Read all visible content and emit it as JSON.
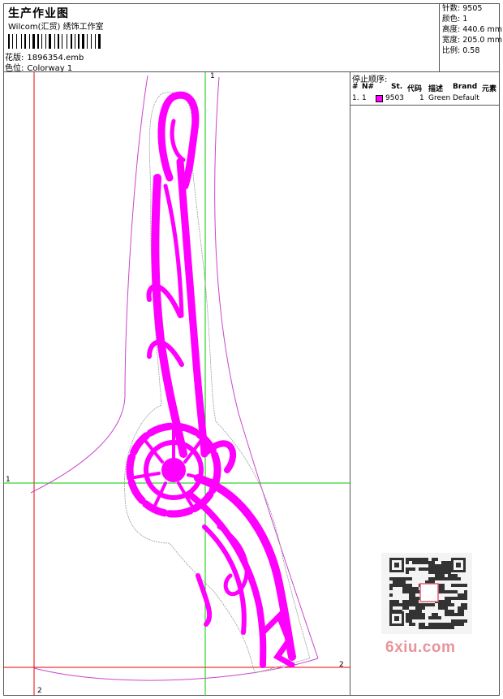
{
  "header": {
    "title": "生产作业图",
    "company": "Wilcom(汇贸) 绣饰工作室",
    "pattern_label": "花版:",
    "pattern_value": "1896354.emb",
    "colorway_label": "色位:",
    "colorway_value": "Colorway 1"
  },
  "stats": {
    "stitches_label": "针数:",
    "stitches_value": "9505",
    "colors_label": "颜色:",
    "colors_value": "1",
    "height_label": "高度:",
    "height_value": "440.6 mm",
    "width_label": "宽度:",
    "width_value": "205.0 mm",
    "scale_label": "比例:",
    "scale_value": "0.58"
  },
  "stop_sequence": {
    "title": "停止顺序:",
    "columns": [
      "#",
      "N#",
      "St.",
      "代码",
      "描述",
      "Brand",
      "元素"
    ],
    "rows": [
      {
        "index": "1.",
        "n": "1",
        "stitches": "9503",
        "code": "1",
        "description": "Green",
        "brand": "Default",
        "element": "",
        "swatch_color": "#ff00ff"
      }
    ]
  },
  "axes": {
    "top": "1",
    "left": "1",
    "right": "2",
    "bottom": "2"
  },
  "watermark": "6xiu.com",
  "colors": {
    "design": "#ff00ff",
    "outline": "#cc44cc",
    "guide_green": "#00cc00",
    "guide_red": "#ee0000"
  }
}
